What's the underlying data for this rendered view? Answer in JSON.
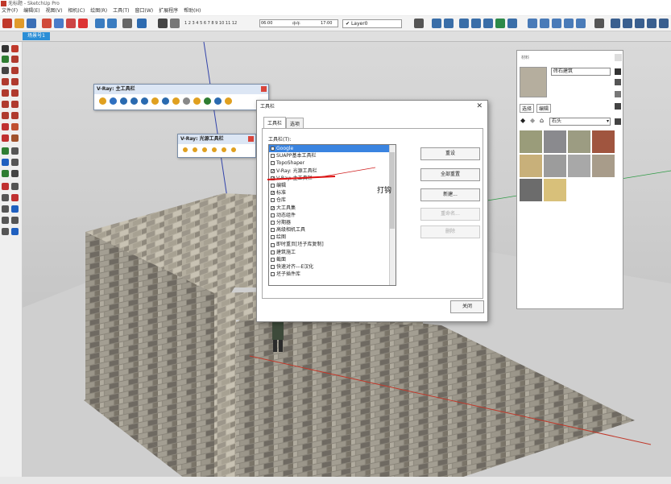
{
  "window": {
    "title": "无标题 - SketchUp Pro"
  },
  "menu": [
    "文件(F)",
    "编辑(E)",
    "视图(V)",
    "相机(C)",
    "绘图(R)",
    "工具(T)",
    "窗口(W)",
    "扩展程序",
    "帮助(H)"
  ],
  "toolbar": {
    "shadow_scale": "1 2 3 4 5 6 7 8 9 10 11 12",
    "time_start": "06:00",
    "time_mid": "中午",
    "time_end": "17:00",
    "layer": "Layer0"
  },
  "scene": {
    "tab": "场景号1"
  },
  "vray_main": {
    "title": "V-Ray: 主工具栏"
  },
  "vray_light": {
    "title": "V-Ray: 光源工具栏"
  },
  "dialog": {
    "title": "工具栏",
    "tabs": [
      "工具栏",
      "选项"
    ],
    "list_label": "工具栏(T):",
    "items": [
      {
        "label": "Google",
        "checked": false,
        "selected": true
      },
      {
        "label": "SUAPP基本工具栏",
        "checked": false
      },
      {
        "label": "TopoShaper",
        "checked": false
      },
      {
        "label": "V-Ray: 光源工具栏",
        "checked": true
      },
      {
        "label": "V-Ray: 主工具栏",
        "checked": true
      },
      {
        "label": "编辑",
        "checked": false
      },
      {
        "label": "标准",
        "checked": true
      },
      {
        "label": "仓库",
        "checked": false
      },
      {
        "label": "大工具集",
        "checked": true
      },
      {
        "label": "动态组件",
        "checked": false
      },
      {
        "label": "分期器",
        "checked": false
      },
      {
        "label": "高级相机工具",
        "checked": false
      },
      {
        "label": "绘图",
        "checked": false
      },
      {
        "label": "即时重页[坯子库复制]",
        "checked": false
      },
      {
        "label": "建筑施工",
        "checked": false
      },
      {
        "label": "截面",
        "checked": false
      },
      {
        "label": "快速对齐---E汉化",
        "checked": false
      },
      {
        "label": "坯子插件库",
        "checked": false
      }
    ],
    "buttons": {
      "reset": "重设",
      "reset_all": "全部重置",
      "new": "新建...",
      "rename": "重命名...",
      "delete": "删除"
    },
    "close": "关闭",
    "annotation": "打钩"
  },
  "materials": {
    "title": "材料",
    "name": "砖石建筑",
    "tab_select": "选择",
    "tab_edit": "编辑",
    "category": "石头",
    "swatches": [
      "#9a9c7a",
      "#8a8a8e",
      "#9c9c82",
      "#a0553f",
      "#c8b07a",
      "#9c9c9c",
      "#a8a8a8",
      "#a89c8a",
      "#6c6c6c",
      "#d8c07a"
    ]
  }
}
